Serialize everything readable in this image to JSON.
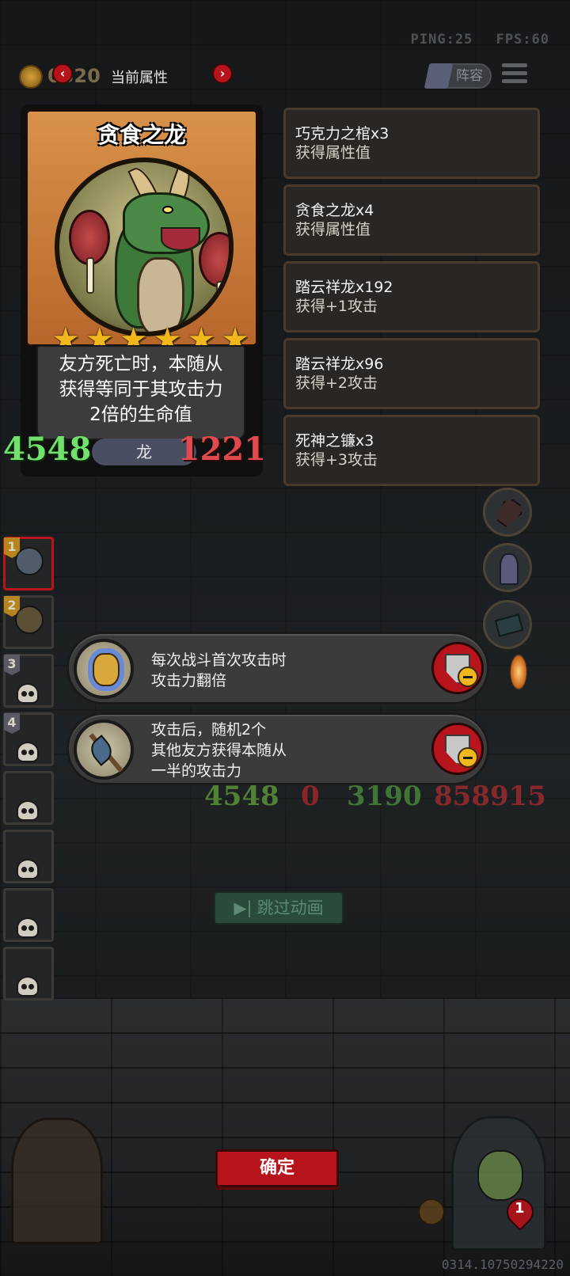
{
  "hud": {
    "ping": "PING:25",
    "fps": "FPS:60",
    "coins": "0320",
    "lineup_label": "阵容"
  },
  "attr_panel": {
    "title": "当前属性",
    "prev": "‹",
    "next": "›"
  },
  "card": {
    "name": "贪食之龙",
    "stars": 6,
    "star_glyph": "★",
    "desc_lines": [
      "友方死亡时，本随从",
      "获得等同于其攻击力",
      "2倍的生命值"
    ],
    "attack": "4548",
    "health": "1221",
    "tribe": "龙"
  },
  "effects": [
    {
      "name": "巧克力之棺x3",
      "desc": "获得属性值"
    },
    {
      "name": "贪食之龙x4",
      "desc": "获得属性值"
    },
    {
      "name": "踏云祥龙x192",
      "desc": "获得+1攻击"
    },
    {
      "name": "踏云祥龙x96",
      "desc": "获得+2攻击"
    },
    {
      "name": "死神之镰x3",
      "desc": "获得+3攻击"
    }
  ],
  "team_slots": [
    "1",
    "2",
    "3",
    "4",
    "",
    "",
    "",
    ""
  ],
  "skills": [
    {
      "lines": [
        "每次战斗首次攻击时",
        "攻击力翻倍"
      ],
      "icon": "crab-icon"
    },
    {
      "lines": [
        "攻击后，随机2个",
        "其他友方获得本随从",
        "一半的攻击力"
      ],
      "icon": "axe-icon"
    }
  ],
  "battle": {
    "attack": "4548",
    "zero": "0",
    "hp": "3190",
    "hp2": "858915"
  },
  "buttons": {
    "skip": "跳过动画",
    "skip_icon": "▶|",
    "confirm": "确定"
  },
  "player": {
    "lives": "1"
  },
  "version": "0314.10750294220"
}
